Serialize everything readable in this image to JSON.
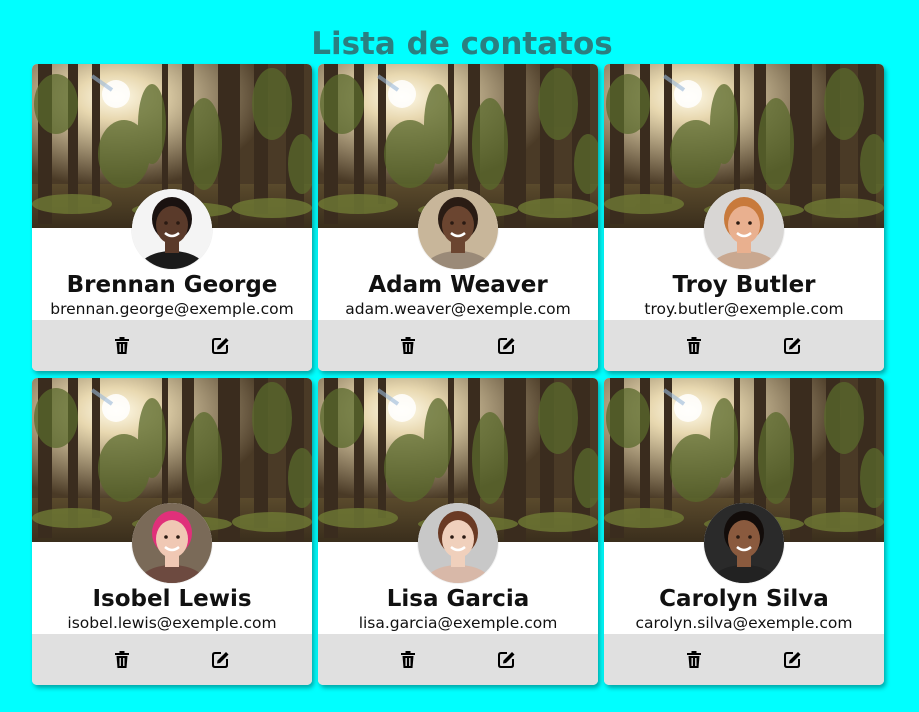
{
  "page": {
    "title": "Lista de contatos"
  },
  "contacts": [
    {
      "name": "Brennan George",
      "email": "brennan.george@exemple.com",
      "avatar": {
        "skin": "#5a3a2a",
        "hair": "#1a1210",
        "bg": "#f4f4f4",
        "shirt": "#1a1a1a"
      }
    },
    {
      "name": "Adam Weaver",
      "email": "adam.weaver@exemple.com",
      "avatar": {
        "skin": "#6b4530",
        "hair": "#2a1c14",
        "bg": "#c8b69a",
        "shirt": "#9a8a78"
      }
    },
    {
      "name": "Troy Butler",
      "email": "troy.butler@exemple.com",
      "avatar": {
        "skin": "#e9b08f",
        "hair": "#c87a3c",
        "bg": "#d8d6d4",
        "shirt": "#c9a890"
      }
    },
    {
      "name": "Isobel Lewis",
      "email": "isobel.lewis@exemple.com",
      "avatar": {
        "skin": "#f0c8b4",
        "hair": "#e0307a",
        "bg": "#7a6a58",
        "shirt": "#6d4a40"
      }
    },
    {
      "name": "Lisa Garcia",
      "email": "lisa.garcia@exemple.com",
      "avatar": {
        "skin": "#f0d0bc",
        "hair": "#6a3a24",
        "bg": "#c8c8c8",
        "shirt": "#d8b8a8"
      }
    },
    {
      "name": "Carolyn Silva",
      "email": "carolyn.silva@exemple.com",
      "avatar": {
        "skin": "#8a5a3e",
        "hair": "#120c0a",
        "bg": "#2a2a2a",
        "shirt": "#222222"
      }
    }
  ],
  "icons": {
    "delete": "trash-icon",
    "edit": "edit-icon",
    "cover": "forest-cover-image"
  },
  "colors": {
    "background": "#00ffff",
    "title": "#2b7f80",
    "actions_bar": "#e0e0e0"
  }
}
